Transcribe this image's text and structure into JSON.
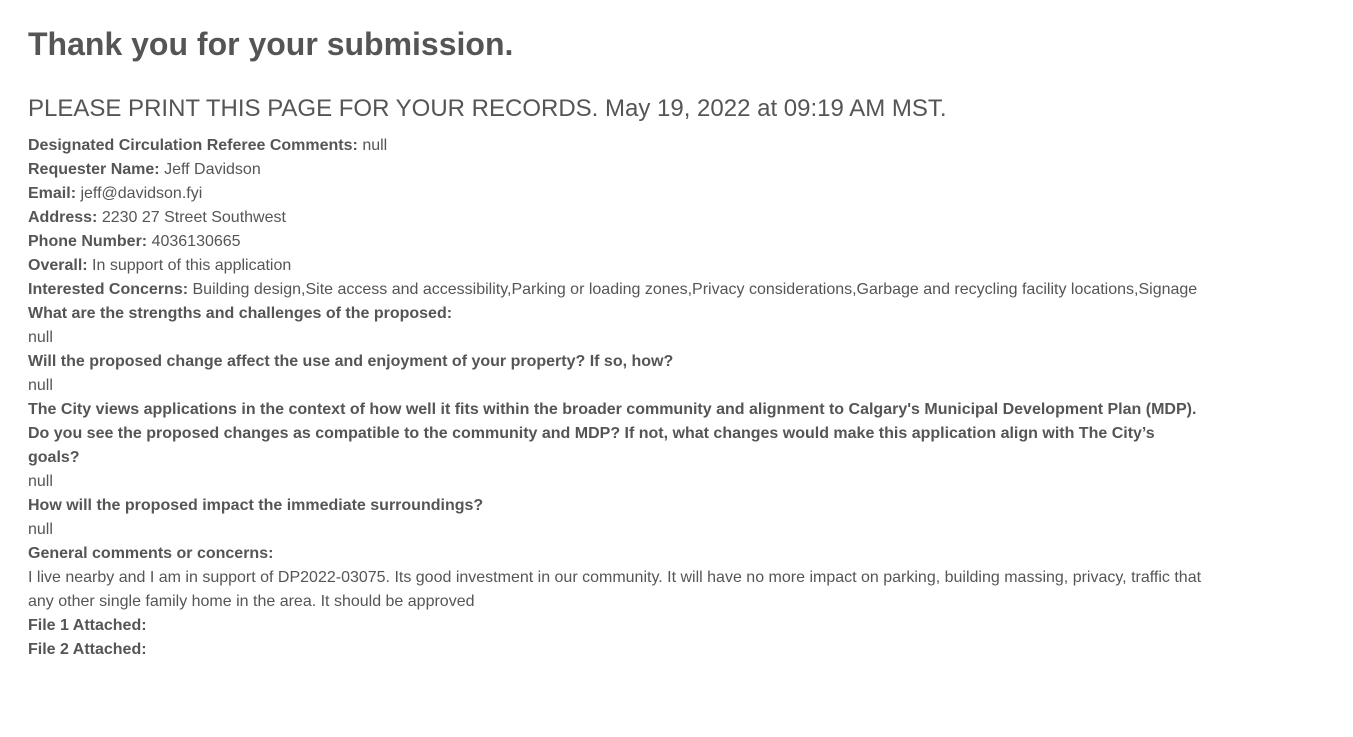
{
  "heading": "Thank you for your submission.",
  "print_notice": "PLEASE PRINT THIS PAGE FOR YOUR RECORDS. May 19, 2022 at 09:19 AM MST.",
  "fields": {
    "referee_comments": {
      "label": "Designated Circulation Referee Comments:",
      "value": "null"
    },
    "requester_name": {
      "label": "Requester Name:",
      "value": "Jeff Davidson"
    },
    "email": {
      "label": "Email:",
      "value": "jeff@davidson.fyi"
    },
    "address": {
      "label": "Address:",
      "value": "2230 27 Street Southwest"
    },
    "phone": {
      "label": "Phone Number:",
      "value": "4036130665"
    },
    "overall": {
      "label": "Overall:",
      "value": "In support of this application"
    },
    "concerns": {
      "label": "Interested Concerns:",
      "value": "Building design,Site access and accessibility,Parking or loading zones,Privacy considerations,Garbage and recycling facility locations,Signage"
    }
  },
  "questions": {
    "strengths": {
      "label": "What are the strengths and challenges of the proposed:",
      "value": "null"
    },
    "enjoyment": {
      "label": "Will the proposed change affect the use and enjoyment of your property? If so, how?",
      "value": "null"
    },
    "mdp": {
      "label": "The City views applications in the context of how well it fits within the broader community and alignment to Calgary's Municipal Development Plan (MDP). Do you see the proposed changes as compatible to the community and MDP? If not, what changes would make this application align with The City’s goals?",
      "value": "null"
    },
    "surroundings": {
      "label": "How will the proposed impact the immediate surroundings?",
      "value": "null"
    },
    "general": {
      "label": "General comments or concerns:",
      "value": "I live nearby and I am in support of DP2022-03075. Its good investment in our community. It will have no more impact on parking, building massing, privacy, traffic that any other single family home in the area. It should be approved"
    }
  },
  "attachments": {
    "file1": {
      "label": "File 1 Attached:",
      "value": ""
    },
    "file2": {
      "label": "File 2 Attached:",
      "value": ""
    }
  }
}
